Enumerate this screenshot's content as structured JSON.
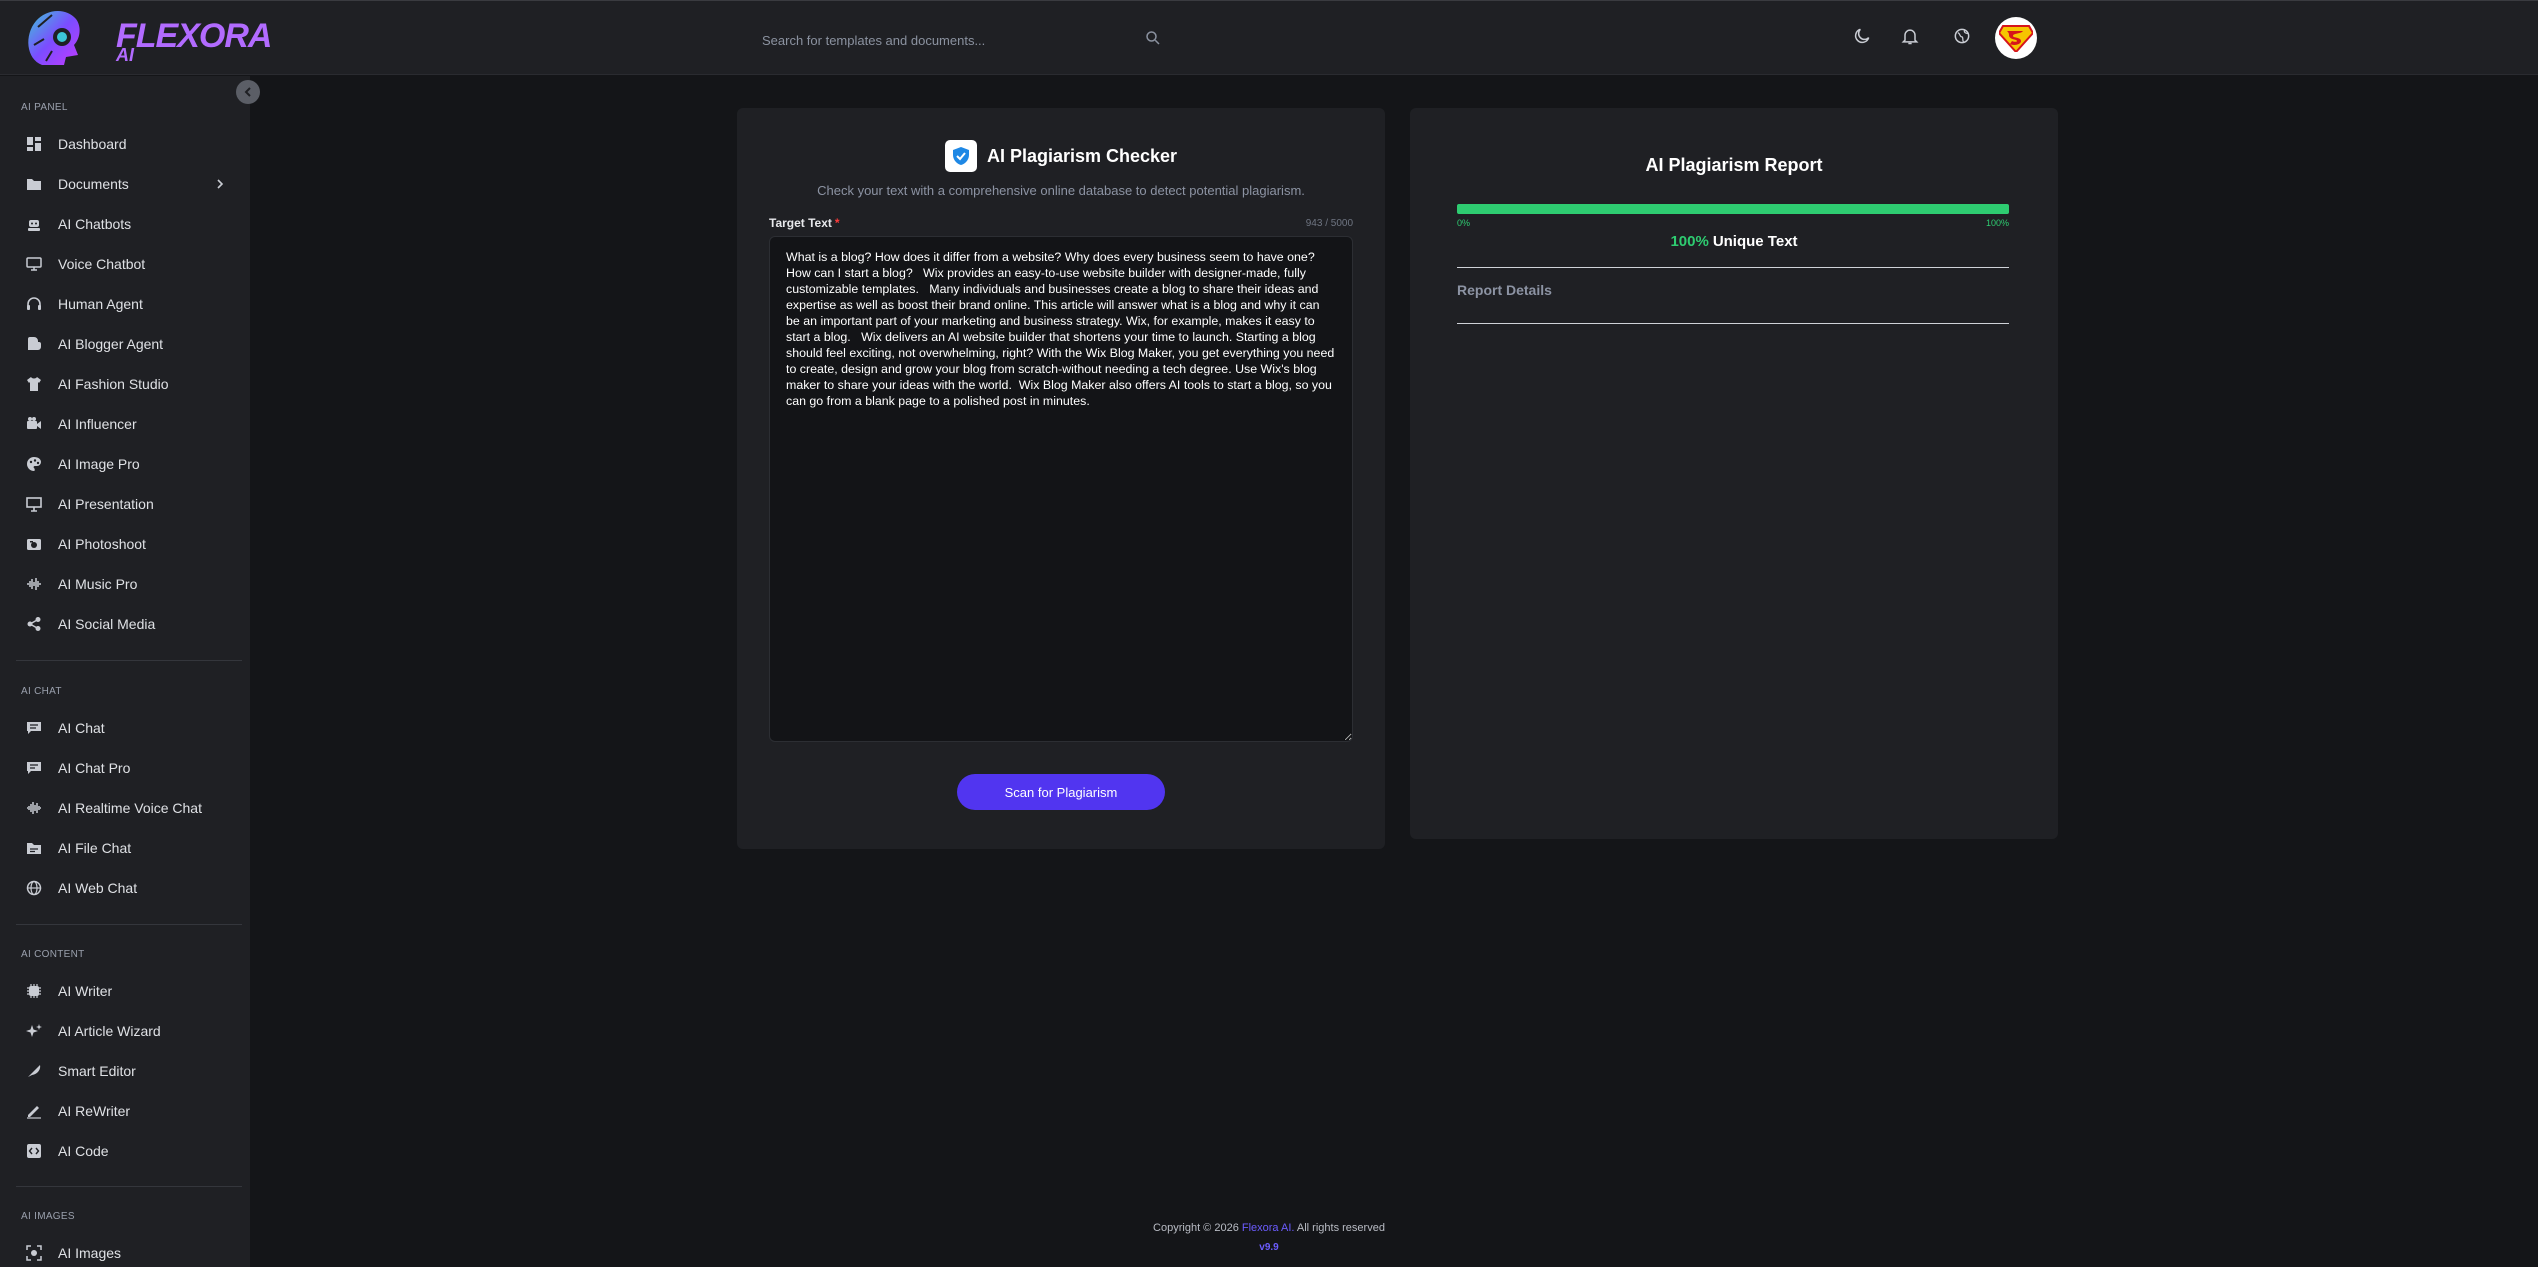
{
  "brand": {
    "name": "FLEXORA",
    "sub": "AI"
  },
  "search": {
    "placeholder": "Search for templates and documents..."
  },
  "sidebar": {
    "sections": [
      {
        "title": "AI PANEL"
      },
      {
        "title": "AI CHAT"
      },
      {
        "title": "AI CONTENT"
      },
      {
        "title": "AI IMAGES"
      }
    ],
    "items": [
      {
        "label": "Dashboard",
        "icon": "dashboard-icon"
      },
      {
        "label": "Documents",
        "icon": "folder-icon"
      },
      {
        "label": "AI Chatbots",
        "icon": "robot-icon"
      },
      {
        "label": "Voice Chatbot",
        "icon": "voice-chat-icon"
      },
      {
        "label": "Human Agent",
        "icon": "headset-icon"
      },
      {
        "label": "AI Blogger Agent",
        "icon": "blogger-icon"
      },
      {
        "label": "AI Fashion Studio",
        "icon": "shirt-icon"
      },
      {
        "label": "AI Influencer",
        "icon": "video-camera-icon"
      },
      {
        "label": "AI Image Pro",
        "icon": "palette-icon"
      },
      {
        "label": "AI Presentation",
        "icon": "presentation-icon"
      },
      {
        "label": "AI Photoshoot",
        "icon": "camera-icon"
      },
      {
        "label": "AI Music Pro",
        "icon": "waveform-icon"
      },
      {
        "label": "AI Social Media",
        "icon": "share-icon"
      },
      {
        "label": "AI Chat",
        "icon": "chat-icon"
      },
      {
        "label": "AI Chat Pro",
        "icon": "chat-pro-icon"
      },
      {
        "label": "AI Realtime Voice Chat",
        "icon": "realtime-voice-icon"
      },
      {
        "label": "AI File Chat",
        "icon": "file-chat-icon"
      },
      {
        "label": "AI Web Chat",
        "icon": "globe-icon"
      },
      {
        "label": "AI Writer",
        "icon": "writer-icon"
      },
      {
        "label": "AI Article Wizard",
        "icon": "sparkles-icon"
      },
      {
        "label": "Smart Editor",
        "icon": "feather-icon"
      },
      {
        "label": "AI ReWriter",
        "icon": "pen-icon"
      },
      {
        "label": "AI Code",
        "icon": "code-icon"
      },
      {
        "label": "AI Images",
        "icon": "image-scan-icon"
      }
    ]
  },
  "checker": {
    "title": "AI Plagiarism Checker",
    "subtitle": "Check your text with a comprehensive online database to detect potential plagiarism.",
    "field_label": "Target Text",
    "required_mark": "*",
    "counter": "943 / 5000",
    "text": "What is a blog? How does it differ from a website? Why does every business seem to have one? How can I start a blog?   Wix provides an easy-to-use website builder with designer-made, fully customizable templates.   Many individuals and businesses create a blog to share their ideas and expertise as well as boost their brand online. This article will answer what is a blog and why it can be an important part of your marketing and business strategy. Wix, for example, makes it easy to start a blog.   Wix delivers an AI website builder that shortens your time to launch. Starting a blog should feel exciting, not overwhelming, right? With the Wix Blog Maker, you get everything you need to create, design and grow your blog from scratch-without needing a tech degree. Use Wix's blog maker to share your ideas with the world.  Wix Blog Maker also offers AI tools to start a blog, so you can go from a blank page to a polished post in minutes.",
    "scan_button": "Scan for Plagiarism"
  },
  "report": {
    "title": "AI Plagiarism Report",
    "progress_min": "0%",
    "progress_max": "100%",
    "unique_percent": 100,
    "unique_percent_label": "100%",
    "unique_label": "Unique Text",
    "details_label": "Report Details"
  },
  "footer": {
    "copyright_prefix": "Copyright © 2026",
    "brand": "Flexora AI.",
    "suffix": "All rights reserved",
    "version": "v9.9"
  },
  "colors": {
    "accent": "#5135f0",
    "success": "#2ecc71",
    "brand": "#b26bff"
  }
}
